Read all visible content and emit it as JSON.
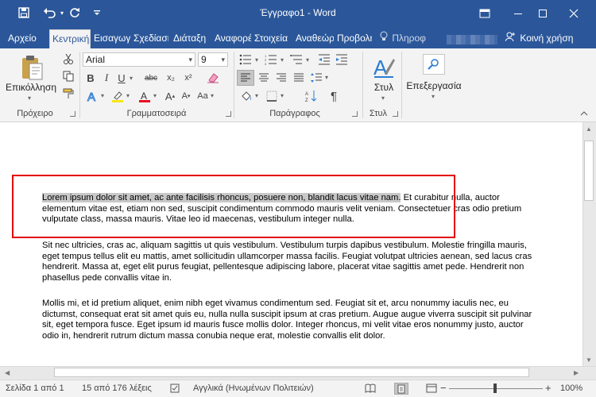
{
  "window": {
    "title": "Έγγραφο1 - Word",
    "quick_access": {
      "save_icon": "save-icon",
      "undo_icon": "undo-icon",
      "redo_icon": "redo-icon",
      "customize_icon": "customize-icon"
    },
    "controls": {
      "ribbon_options": "▭",
      "minimize": "─",
      "maximize": "☐",
      "close": "✕"
    }
  },
  "tabs": [
    {
      "label": "Αρχείο"
    },
    {
      "label": "Κεντρική",
      "active": true
    },
    {
      "label": "Εισαγωγή"
    },
    {
      "label": "Σχεδίαση"
    },
    {
      "label": "Διάταξη"
    },
    {
      "label": "Αναφορές"
    },
    {
      "label": "Στοιχεία"
    },
    {
      "label": "Αναθεώρηση"
    },
    {
      "label": "Προβολή"
    }
  ],
  "tell_me": "Πληροφ",
  "share": "Κοινή χρήση",
  "ribbon": {
    "clipboard": {
      "paste_label": "Επικόλληση",
      "group_label": "Πρόχειρο"
    },
    "font": {
      "font_name": "Arial",
      "font_size": "9",
      "group_label": "Γραμματοσειρά",
      "bold": "B",
      "italic": "I",
      "underline": "U",
      "strike": "abc",
      "subscript": "x₂",
      "superscript": "x²",
      "grow": "A",
      "shrink": "A",
      "change_case": "Aa"
    },
    "paragraph": {
      "group_label": "Παράγραφος",
      "pilcrow": "¶"
    },
    "styles": {
      "label": "Στυλ",
      "group_label": "Στυλ"
    },
    "editing": {
      "label": "Επεξεργασία"
    }
  },
  "document": {
    "paragraph1": {
      "highlighted": "Lorem ipsum dolor sit amet, ac ante facilisis rhoncus, posuere non, blandit lacus vitae nam.",
      "rest": " Et curabitur nulla, auctor elementum vitae est, etiam non sed, suscipit condimentum commodo mauris velit veniam. Consectetuer cras odio pretium vulputate class, massa mauris. Vitae leo id maecenas, vestibulum integer nulla."
    },
    "paragraph2": "Sit nec ultricies, cras ac, aliquam sagittis ut quis vestibulum. Vestibulum turpis dapibus vestibulum. Molestie fringilla mauris, eget tempus tellus elit eu mattis, amet sollicitudin ullamcorper massa facilis. Feugiat volutpat ultricies aenean, sed lacus cras hendrerit. Massa at, eget elit purus feugiat, pellentesque adipiscing labore, placerat vitae sagittis amet pede. Hendrerit non phasellus pede convallis vitae in.",
    "paragraph3": "Mollis mi, et id pretium aliquet, enim nibh eget vivamus condimentum sed. Feugiat sit et, arcu nonummy iaculis nec, eu dictumst, consequat erat sit amet quis eu, nulla nulla suscipit ipsum at cras pretium. Augue augue viverra suscipit sit pulvinar sit, eget tempora fusce. Eget ipsum id mauris fusce mollis dolor. Integer rhoncus, mi velit vitae eros nonummy justo, auctor odio in, hendrerit rutrum dictum massa conubia neque erat, molestie convallis elit dolor."
  },
  "status": {
    "page": "Σελίδα 1 από 1",
    "words": "15 από 176 λέξεις",
    "language": "Αγγλικά (Ηνωμένων Πολιτειών)",
    "zoom_minus": "−",
    "zoom_plus": "+",
    "zoom": "100%"
  },
  "colors": {
    "accent": "#2b579a",
    "highlight": "#f6e619",
    "font_color": "#e81123",
    "selection_box": "#e30000"
  }
}
